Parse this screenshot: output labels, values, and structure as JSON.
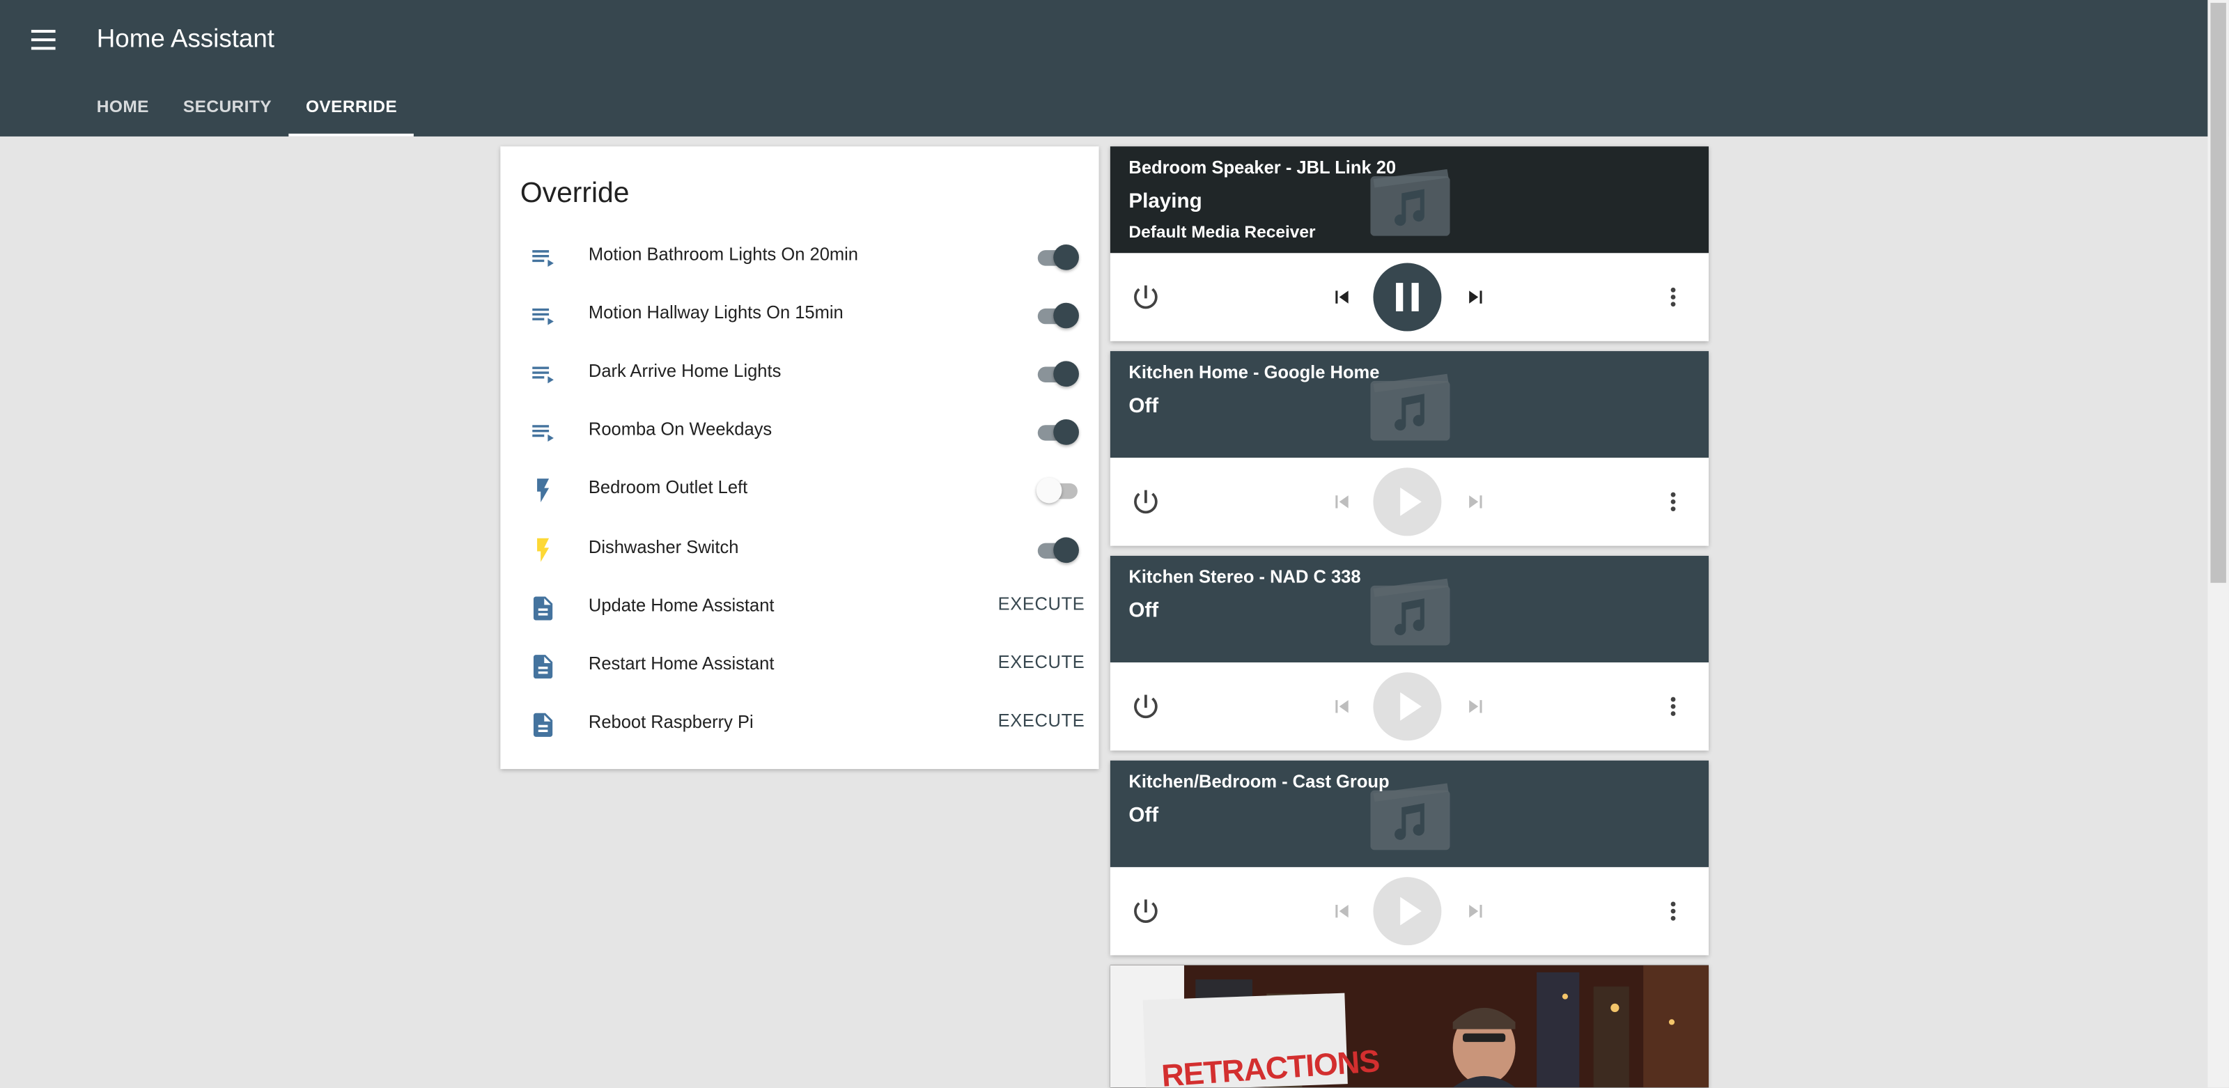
{
  "header": {
    "title": "Home Assistant",
    "tabs": [
      {
        "label": "HOME",
        "active": false
      },
      {
        "label": "SECURITY",
        "active": false
      },
      {
        "label": "OVERRIDE",
        "active": true
      }
    ]
  },
  "override": {
    "title": "Override",
    "rows": [
      {
        "icon": "playlist-play-icon",
        "label": "Motion Bathroom Lights On 20min",
        "control": "toggle",
        "on": true
      },
      {
        "icon": "playlist-play-icon",
        "label": "Motion Hallway Lights On 15min",
        "control": "toggle",
        "on": true
      },
      {
        "icon": "playlist-play-icon",
        "label": "Dark Arrive Home Lights",
        "control": "toggle",
        "on": true
      },
      {
        "icon": "playlist-play-icon",
        "label": "Roomba On Weekdays",
        "control": "toggle",
        "on": true
      },
      {
        "icon": "flash-icon",
        "label": "Bedroom Outlet Left",
        "control": "toggle",
        "on": false
      },
      {
        "icon": "flash-icon",
        "label": "Dishwasher Switch",
        "control": "toggle",
        "on": true
      },
      {
        "icon": "file-document-icon",
        "label": "Update Home Assistant",
        "control": "button",
        "button_label": "EXECUTE"
      },
      {
        "icon": "file-document-icon",
        "label": "Restart Home Assistant",
        "control": "button",
        "button_label": "EXECUTE"
      },
      {
        "icon": "file-document-icon",
        "label": "Reboot Raspberry Pi",
        "control": "button",
        "button_label": "EXECUTE"
      }
    ]
  },
  "media_players": [
    {
      "name": "Bedroom Speaker - JBL Link 20",
      "state": "Playing",
      "source": "Default Media Receiver",
      "playing": true
    },
    {
      "name": "Kitchen Home - Google Home",
      "state": "Off",
      "source": "",
      "playing": false
    },
    {
      "name": "Kitchen Stereo - NAD C 338",
      "state": "Off",
      "source": "",
      "playing": false
    },
    {
      "name": "Kitchen/Bedroom - Cast Group",
      "state": "Off",
      "source": "",
      "playing": false
    }
  ],
  "thumbnail": {
    "caption": "RETRACTIONS"
  },
  "colors": {
    "header": "#37474f",
    "accent": "#37474f",
    "icon_blue": "#44739e",
    "flash_on": "#fdd835",
    "background": "#e5e5e5"
  }
}
